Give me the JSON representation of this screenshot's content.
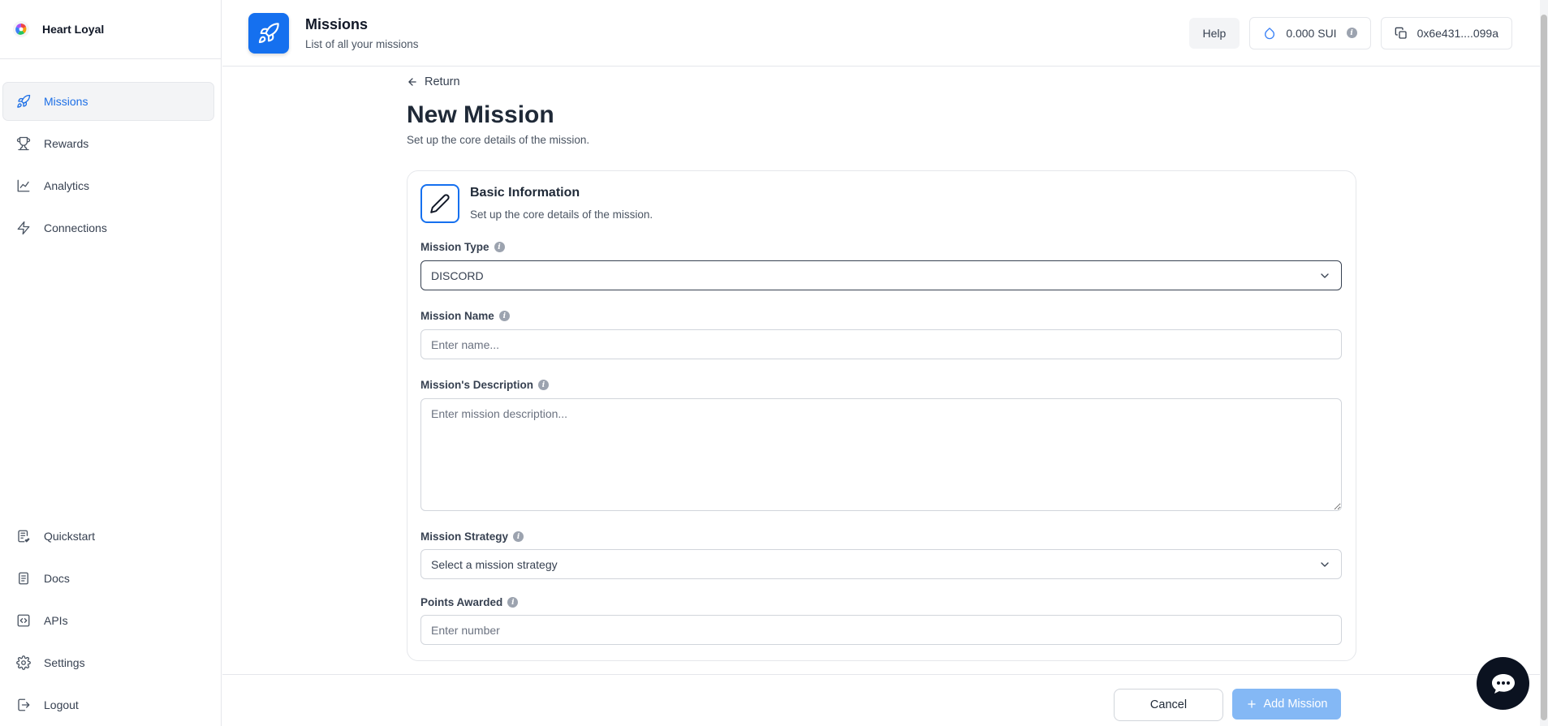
{
  "brand": {
    "name": "Heart Loyal"
  },
  "sidebar": {
    "items": [
      {
        "label": "Missions",
        "icon": "rocket-icon",
        "active": true
      },
      {
        "label": "Rewards",
        "icon": "trophy-icon"
      },
      {
        "label": "Analytics",
        "icon": "chart-line-icon"
      },
      {
        "label": "Connections",
        "icon": "zap-icon"
      }
    ],
    "bottom_items": [
      {
        "label": "Quickstart",
        "icon": "checklist-icon"
      },
      {
        "label": "Docs",
        "icon": "document-icon"
      },
      {
        "label": "APIs",
        "icon": "code-icon"
      },
      {
        "label": "Settings",
        "icon": "gear-icon"
      },
      {
        "label": "Logout",
        "icon": "logout-icon"
      }
    ]
  },
  "header": {
    "title": "Missions",
    "subtitle": "List of all your missions",
    "help_label": "Help",
    "balance": "0.000 SUI",
    "wallet": "0x6e431....099a"
  },
  "page": {
    "return_label": "Return",
    "title": "New Mission",
    "subtitle": "Set up the core details of the mission."
  },
  "card": {
    "title": "Basic Information",
    "subtitle": "Set up the core details of the mission."
  },
  "form": {
    "mission_type": {
      "label": "Mission Type",
      "value": "DISCORD"
    },
    "mission_name": {
      "label": "Mission Name",
      "placeholder": "Enter name..."
    },
    "description": {
      "label": "Mission's Description",
      "placeholder": "Enter mission description..."
    },
    "strategy": {
      "label": "Mission Strategy",
      "value": "Select a mission strategy"
    },
    "points": {
      "label": "Points Awarded",
      "placeholder": "Enter number"
    }
  },
  "footer": {
    "cancel_label": "Cancel",
    "add_label": "Add Mission"
  },
  "colors": {
    "accent": "#1570ef",
    "accent_disabled": "#84b8f5",
    "active_nav": "#1d6fe6"
  }
}
